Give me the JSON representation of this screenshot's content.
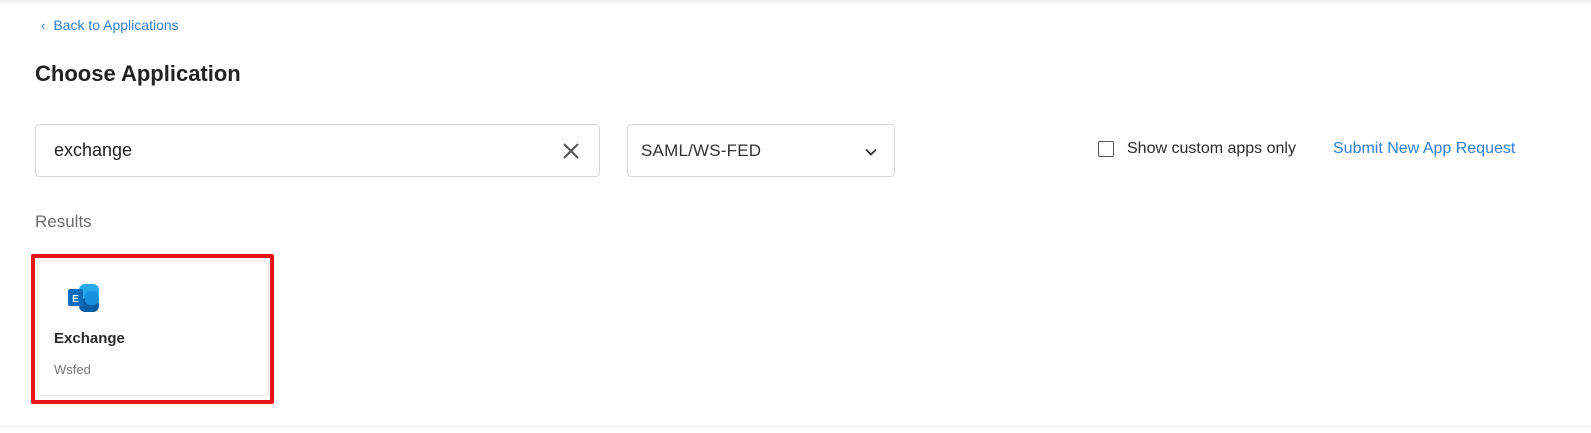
{
  "nav": {
    "back_label": "Back to Applications",
    "back_icon": "chevron-left-icon"
  },
  "page": {
    "title": "Choose Application"
  },
  "search": {
    "value": "exchange",
    "clear_icon": "close-icon"
  },
  "filter": {
    "selected": "SAML/WS-FED",
    "icon": "chevron-down-icon"
  },
  "custom_apps": {
    "label": "Show custom apps only",
    "checked": false
  },
  "submit_link": {
    "label": "Submit New App Request"
  },
  "results": {
    "label": "Results",
    "items": [
      {
        "name": "Exchange",
        "protocol": "Wsfed",
        "icon": "exchange-icon",
        "highlighted": true
      }
    ]
  },
  "colors": {
    "link": "#2f80d6",
    "highlight": "#e8141a",
    "exchange_dark": "#0a5ea8",
    "exchange_light": "#28a8ea"
  }
}
